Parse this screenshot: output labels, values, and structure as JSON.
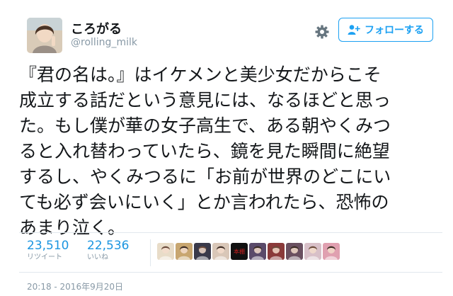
{
  "user": {
    "display_name": "ころがる",
    "handle": "@rolling_milk"
  },
  "follow_button": {
    "label": "フォローする",
    "icon": "user-plus-icon"
  },
  "settings_icon": "gear-icon",
  "tweet": {
    "lines": [
      "『君の名は。』はイケメンと美少女だからこそ",
      "成立する話だという意見には、なるほどと思っ",
      "た。もし僕が華の女子高生で、ある朝やくみつ",
      "ると入れ替わっていたら、鏡を見た瞬間に絶望",
      "するし、やくみつるに「お前が世界のどこにい",
      "ても必ず会いにいく」とか言われたら、恐怖の",
      "あまり泣く。"
    ]
  },
  "stats": {
    "retweets": {
      "value": "23,510",
      "label": "リツイート"
    },
    "likes": {
      "value": "22,536",
      "label": "いいね"
    }
  },
  "likers": [
    {
      "name": "liker-avatar-1",
      "color": "#e8dcc8"
    },
    {
      "name": "liker-avatar-2",
      "color": "#c8a670"
    },
    {
      "name": "liker-avatar-3",
      "color": "#3a3a4a"
    },
    {
      "name": "liker-avatar-4",
      "color": "#d9c7b8"
    },
    {
      "name": "liker-avatar-5",
      "color": "#111111",
      "text": "本棚"
    },
    {
      "name": "liker-avatar-6",
      "color": "#5a4a6a"
    },
    {
      "name": "liker-avatar-7",
      "color": "#8a3a3a"
    },
    {
      "name": "liker-avatar-8",
      "color": "#6a5060"
    },
    {
      "name": "liker-avatar-9",
      "color": "#d8c0c8"
    },
    {
      "name": "liker-avatar-10",
      "color": "#e0a0b0"
    }
  ],
  "timestamp": "20:18 - 2016年9月20日",
  "colors": {
    "accent": "#1da1f2",
    "stat_value": "#1b95e0",
    "muted": "#8899a6",
    "text": "#14171a",
    "divider": "#e1e8ed"
  }
}
